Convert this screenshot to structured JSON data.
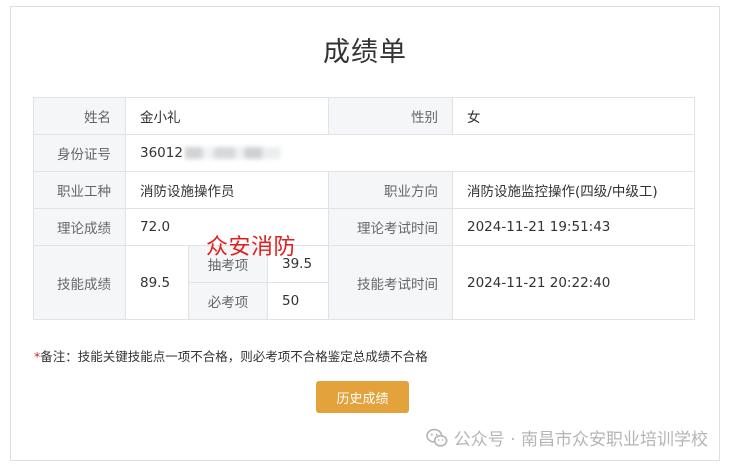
{
  "page": {
    "title": "成绩单",
    "watermark": "众安消防",
    "note_star": "*",
    "note": "备注：技能关键技能点一项不合格，则必考项不合格鉴定总成绩不合格",
    "history_button": "历史成绩",
    "footer_text": "公众号 · 南昌市众安职业培训学校",
    "footer_icon": "wechat-icon"
  },
  "grade": {
    "name_label": "姓名",
    "name_value": "金小礼",
    "gender_label": "性别",
    "gender_value": "女",
    "id_label": "身份证号",
    "id_value": "36012",
    "occupation_label": "职业工种",
    "occupation_value": "消防设施操作员",
    "direction_label": "职业方向",
    "direction_value": "消防设施监控操作(四级/中级工)",
    "theory_label": "理论成绩",
    "theory_value": "72.0",
    "theory_time_label": "理论考试时间",
    "theory_time_value": "2024-11-21 19:51:43",
    "skill_label": "技能成绩",
    "skill_value": "89.5",
    "sample_label": "抽考项",
    "sample_value": "39.5",
    "required_label": "必考项",
    "required_value": "50",
    "skill_time_label": "技能考试时间",
    "skill_time_value": "2024-11-21 20:22:40"
  },
  "colors": {
    "button": "#e3a23c",
    "skill_score": "#3c8bd5",
    "watermark": "#e02020",
    "label_bg": "#f5f6f7"
  }
}
